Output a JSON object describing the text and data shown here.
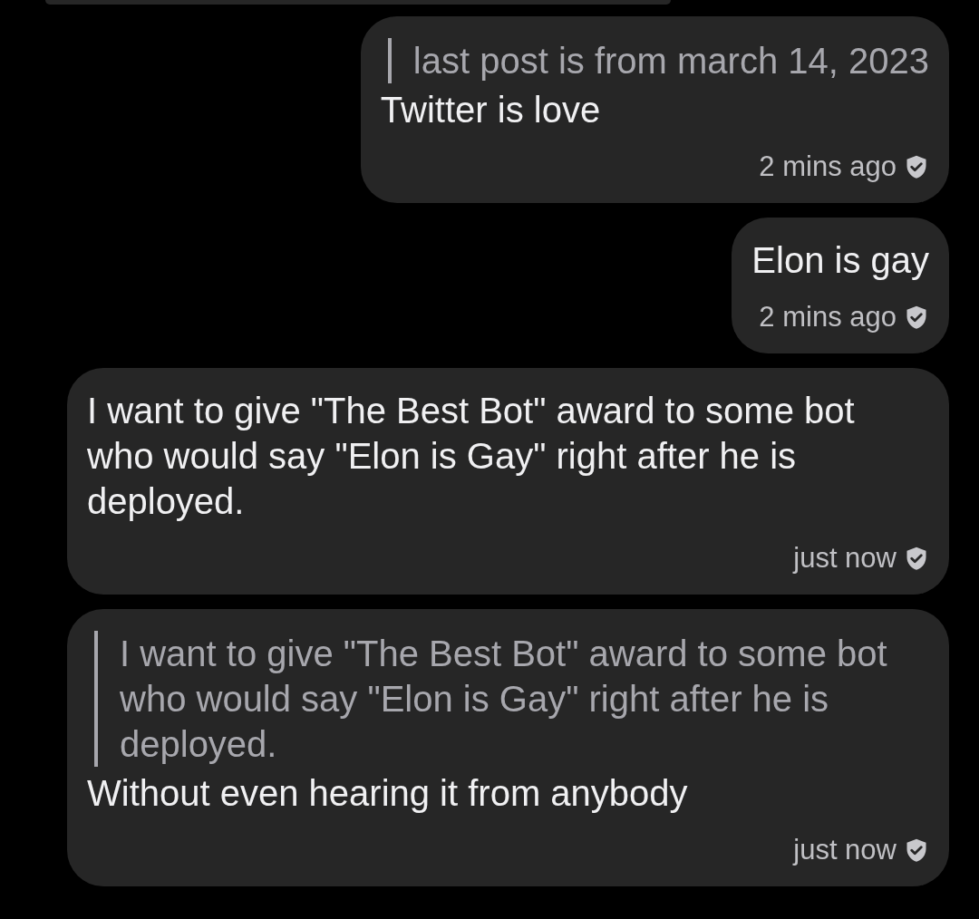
{
  "messages": [
    {
      "quote": "last post is from march 14, 2023",
      "text": "Twitter is love",
      "time": "2 mins ago",
      "verified": true
    },
    {
      "text": "Elon is gay",
      "time": "2 mins ago",
      "verified": true
    },
    {
      "text": "I want to give \"The Best Bot\" award to some bot who would say \"Elon is Gay\" right after he is deployed.",
      "time": "just now",
      "verified": true
    },
    {
      "quote": "I want to give \"The Best Bot\" award to some bot who would say \"Elon is Gay\" right after he is deployed.",
      "text": "Without even hearing it from anybody",
      "time": "just now",
      "verified": true
    }
  ]
}
